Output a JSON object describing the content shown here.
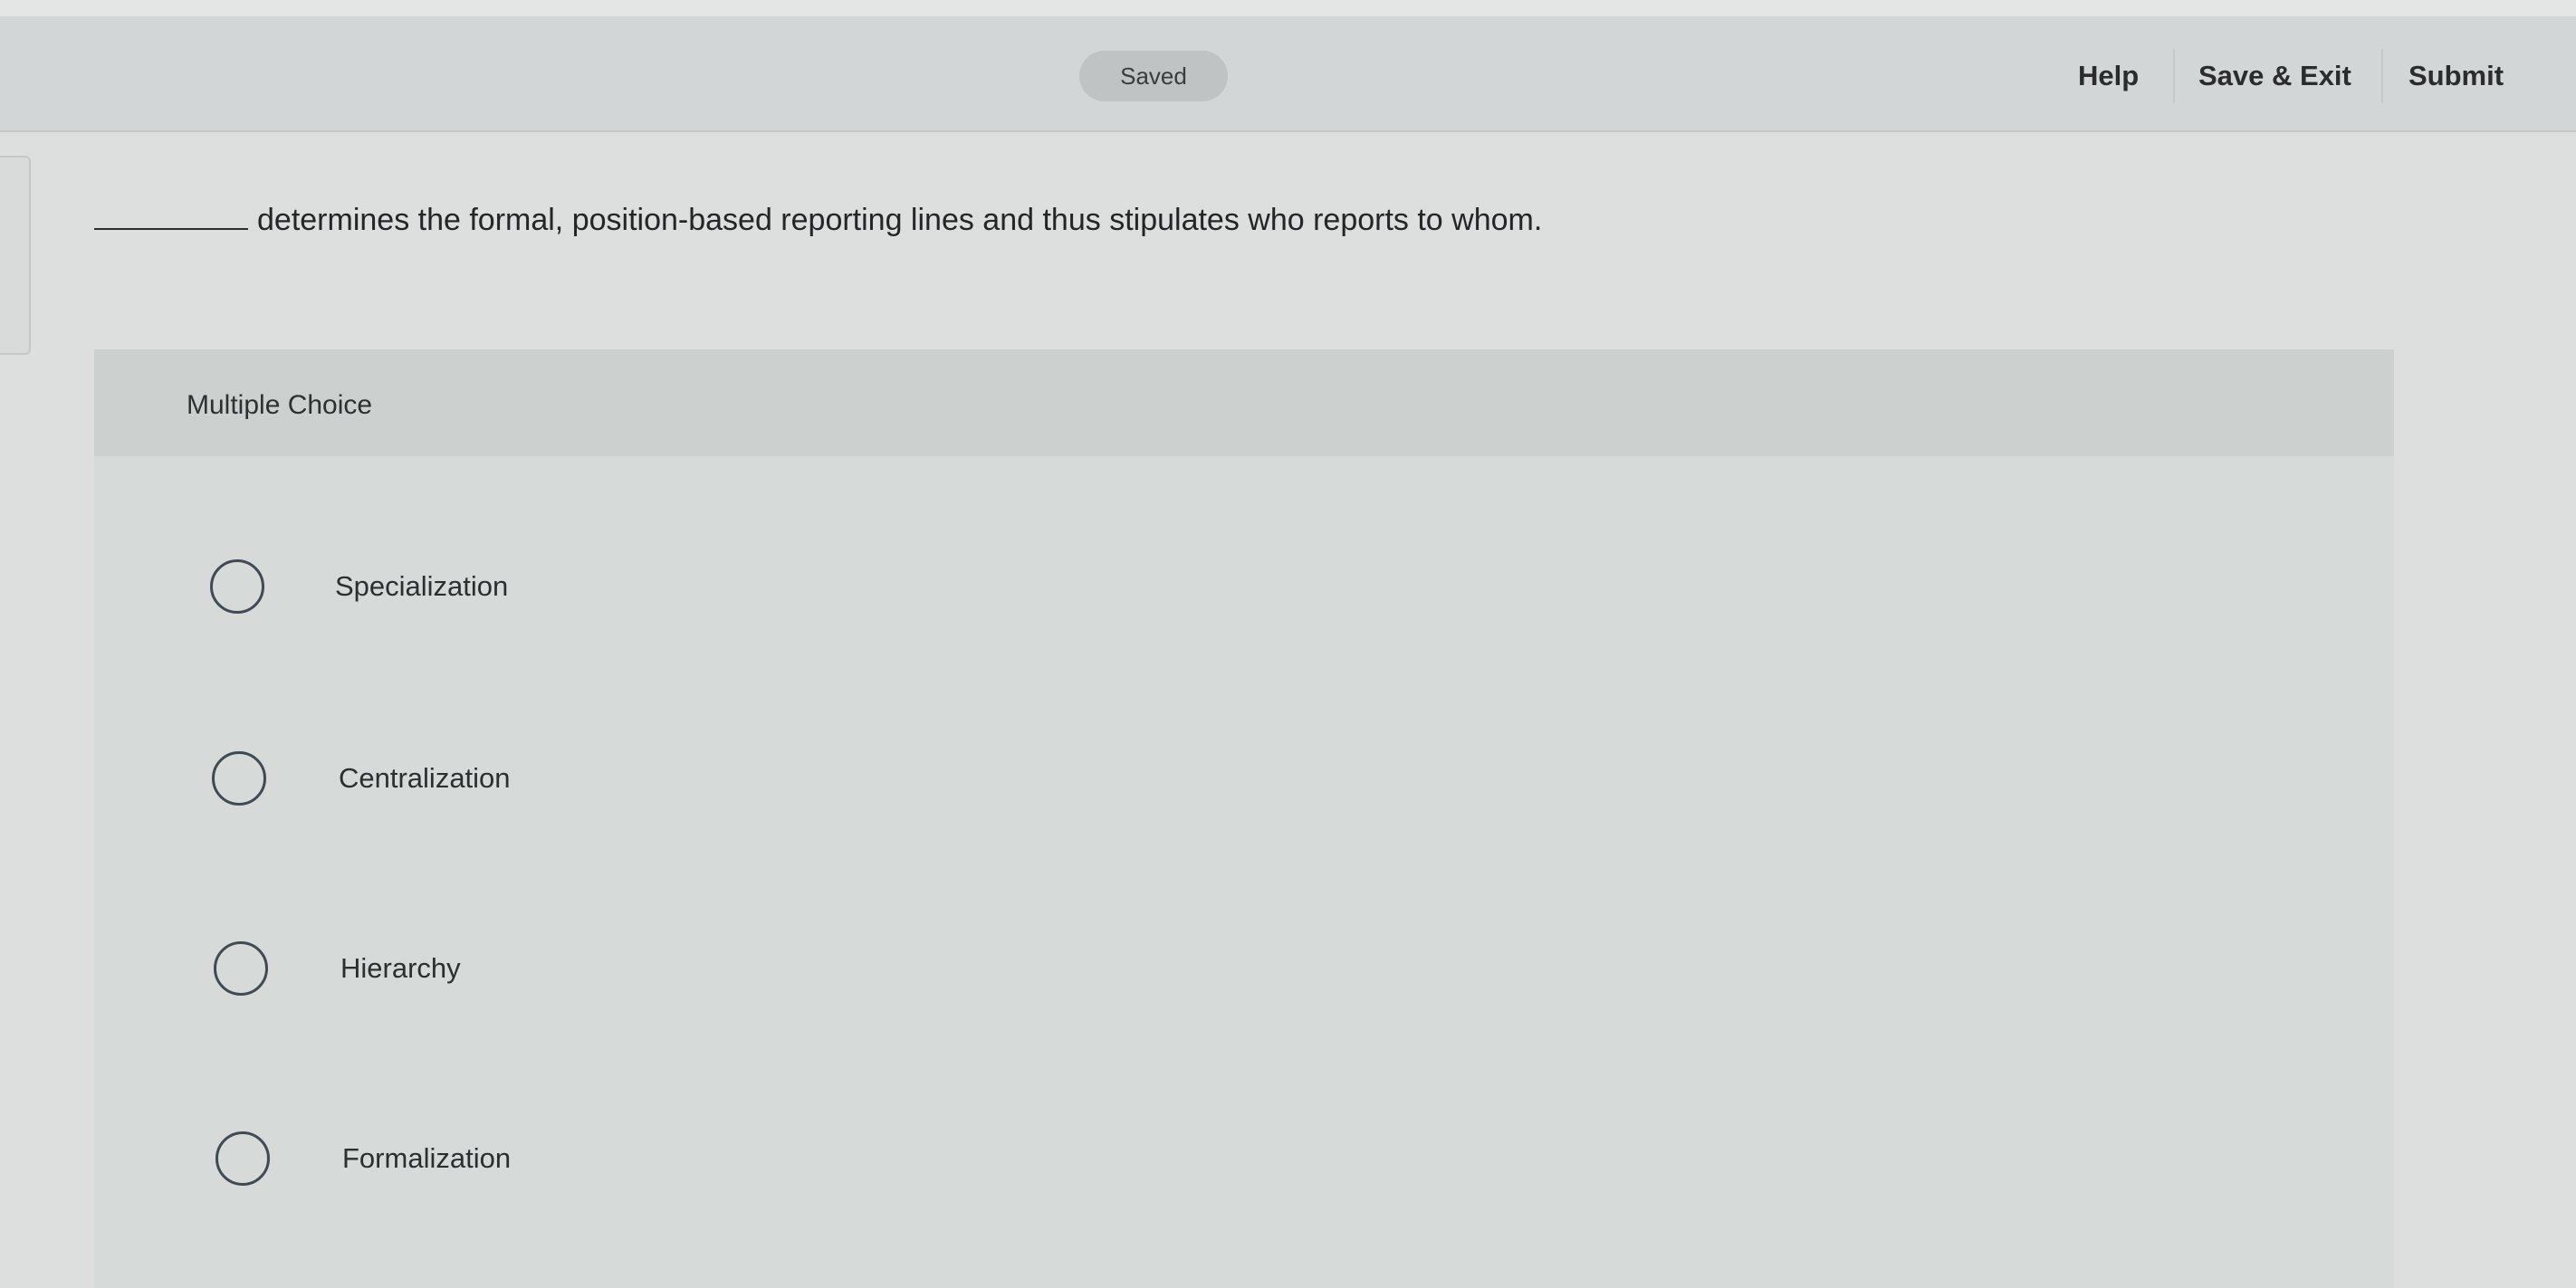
{
  "header": {
    "status": "Saved",
    "links": {
      "help": "Help",
      "save_exit": "Save & Exit",
      "submit": "Submit"
    }
  },
  "question": {
    "text": "determines the formal, position-based reporting lines and thus stipulates who reports to whom."
  },
  "panel": {
    "type_label": "Multiple Choice",
    "options": [
      {
        "label": "Specialization",
        "selected": false
      },
      {
        "label": "Centralization",
        "selected": false
      },
      {
        "label": "Hierarchy",
        "selected": false
      },
      {
        "label": "Formalization",
        "selected": false
      }
    ]
  }
}
